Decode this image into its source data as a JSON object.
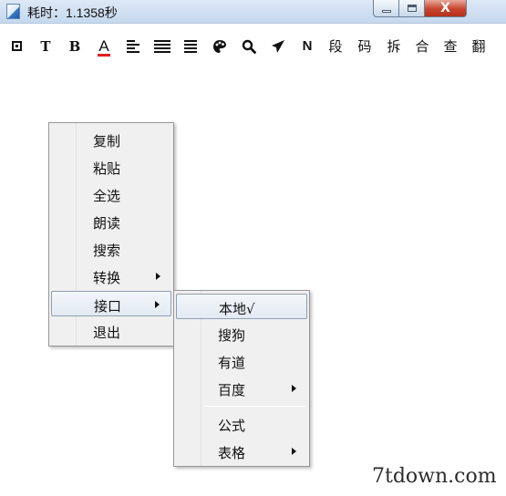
{
  "window": {
    "title": "耗时：1.1358秒",
    "close_glyph": "X"
  },
  "toolbar": {
    "items": [
      {
        "name": "square-icon",
        "label": ""
      },
      {
        "name": "text-t-icon",
        "label": "T"
      },
      {
        "name": "bold-b-icon",
        "label": "B"
      },
      {
        "name": "font-color-icon",
        "label": "A"
      },
      {
        "name": "align-left-icon",
        "label": ""
      },
      {
        "name": "align-center-icon",
        "label": ""
      },
      {
        "name": "align-right-icon",
        "label": ""
      },
      {
        "name": "palette-icon",
        "label": ""
      },
      {
        "name": "magnifier-icon",
        "label": ""
      },
      {
        "name": "send-icon",
        "label": ""
      },
      {
        "name": "n-icon",
        "label": "N"
      },
      {
        "name": "paragraph-button",
        "label": "段"
      },
      {
        "name": "code-button",
        "label": "码"
      },
      {
        "name": "split-button",
        "label": "拆"
      },
      {
        "name": "merge-button",
        "label": "合"
      },
      {
        "name": "lookup-button",
        "label": "查"
      },
      {
        "name": "translate-button",
        "label": "翻"
      }
    ],
    "accent_color": "#e02020"
  },
  "context_menu": {
    "items": [
      {
        "label": "复制",
        "submenu": false
      },
      {
        "label": "粘贴",
        "submenu": false
      },
      {
        "label": "全选",
        "submenu": false
      },
      {
        "label": "朗读",
        "submenu": false
      },
      {
        "label": "搜索",
        "submenu": false
      },
      {
        "label": "转换",
        "submenu": true
      },
      {
        "label": "接口",
        "submenu": true,
        "highlighted": true
      },
      {
        "label": "退出",
        "submenu": false
      }
    ]
  },
  "submenu": {
    "items": [
      {
        "label": "本地√",
        "submenu": false,
        "highlighted": true
      },
      {
        "label": "搜狗",
        "submenu": false
      },
      {
        "label": "有道",
        "submenu": false
      },
      {
        "label": "百度",
        "submenu": true
      },
      {
        "label": "公式",
        "submenu": false
      },
      {
        "label": "表格",
        "submenu": true
      }
    ]
  },
  "watermark": "7tdown.com"
}
